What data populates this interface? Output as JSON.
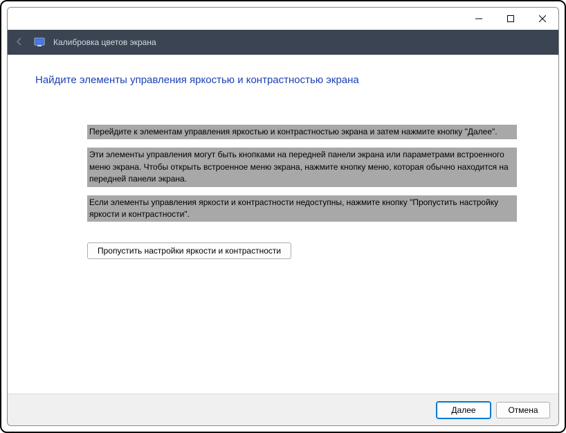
{
  "titlebar": {
    "app_title": "Калибровка цветов экрана"
  },
  "content": {
    "heading": "Найдите элементы управления яркостью и контрастностью экрана",
    "para1": "Перейдите к элементам управления яркостью и контрастностью экрана и затем нажмите кнопку \"Далее\".",
    "para2": "Эти элементы управления могут быть кнопками на передней панели экрана или параметрами встроенного меню экрана. Чтобы открыть встроенное меню экрана, нажмите кнопку меню, которая обычно находится на передней панели экрана.",
    "para3": "Если элементы  управления яркости и контрастности недоступны, нажмите кнопку \"Пропустить настройку яркости и контрастности\".",
    "skip_button": "Пропустить настройки яркости и контрастности"
  },
  "footer": {
    "next": "Далее",
    "cancel": "Отмена"
  }
}
